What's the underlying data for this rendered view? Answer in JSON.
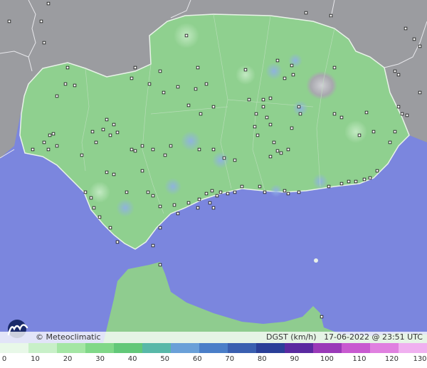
{
  "attribution": "© Meteoclimatic",
  "variable": "DGST (km/h)",
  "timestamp": "17-06-2022 @ 23:51 UTC",
  "legend": {
    "ticks": [
      "0",
      "10",
      "20",
      "30",
      "40",
      "50",
      "60",
      "70",
      "80",
      "90",
      "100",
      "110",
      "120",
      "130"
    ],
    "colors": [
      "#e8f8e8",
      "#c8f0c8",
      "#a4e6a4",
      "#80d888",
      "#62c878",
      "#58b8a8",
      "#6aa0d8",
      "#4a7ec8",
      "#3a5fb0",
      "#2a3f98",
      "#5a2aa0",
      "#9a3ab8",
      "#c85ad0",
      "#e080e0",
      "#f0b0f0"
    ]
  },
  "colors": {
    "sea": "#7b86de",
    "land_region": "#8fd08f",
    "land_outside": "#9a9a9a"
  }
}
